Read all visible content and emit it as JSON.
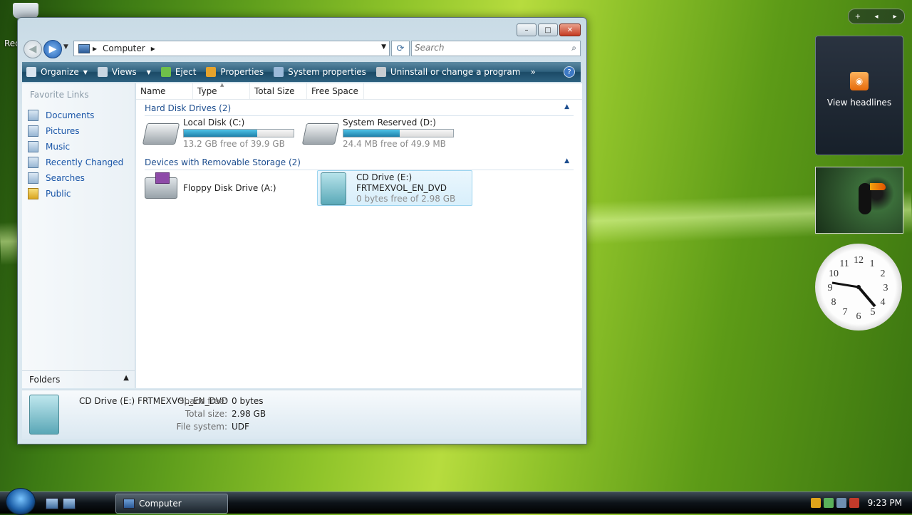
{
  "desktop": {
    "recycle_label": "Rec"
  },
  "window": {
    "title_buttons": {
      "minimize": "–",
      "maximize": "□",
      "close": "✕"
    },
    "address": {
      "crumb": "Computer"
    },
    "search": {
      "placeholder": "Search"
    },
    "toolbar": {
      "organize": "Organize",
      "views": "Views",
      "eject": "Eject",
      "properties": "Properties",
      "system_properties": "System properties",
      "uninstall": "Uninstall or change a program",
      "more": "»"
    },
    "left_pane": {
      "favorite_links_header": "Favorite Links",
      "links": [
        "Documents",
        "Pictures",
        "Music",
        "Recently Changed",
        "Searches",
        "Public"
      ],
      "folders_label": "Folders"
    },
    "columns": [
      "Name",
      "Type",
      "Total Size",
      "Free Space"
    ],
    "groups": {
      "hard_disks": "Hard Disk Drives (2)",
      "removable": "Devices with Removable Storage (2)"
    },
    "drives": {
      "c": {
        "name": "Local Disk (C:)",
        "free": "13.2 GB free of 39.9 GB",
        "used_fraction": 0.67
      },
      "d": {
        "name": "System Reserved (D:)",
        "free": "24.4 MB free of 49.9 MB",
        "used_fraction": 0.51
      },
      "a": {
        "name": "Floppy Disk Drive (A:)"
      },
      "e": {
        "name": "CD Drive (E:)",
        "label": "FRTMEXVOL_EN_DVD",
        "free": "0 bytes free of 2.98 GB"
      }
    },
    "details": {
      "title": "CD Drive (E:) FRTMEXVOL_EN_DVD",
      "space_free_label": "Space free:",
      "space_free": "0 bytes",
      "total_size_label": "Total size:",
      "total_size": "2.98 GB",
      "file_system_label": "File system:",
      "file_system": "UDF"
    }
  },
  "sidebar": {
    "controls": {
      "add": "+",
      "prev": "◂",
      "next": "▸"
    },
    "feed_text": "View headlines"
  },
  "taskbar": {
    "task_label": "Computer",
    "time": "9:23 PM"
  },
  "colors": {
    "toolbar": "#2f617e",
    "link": "#1a56a8",
    "progress": "#1f7fa8"
  }
}
